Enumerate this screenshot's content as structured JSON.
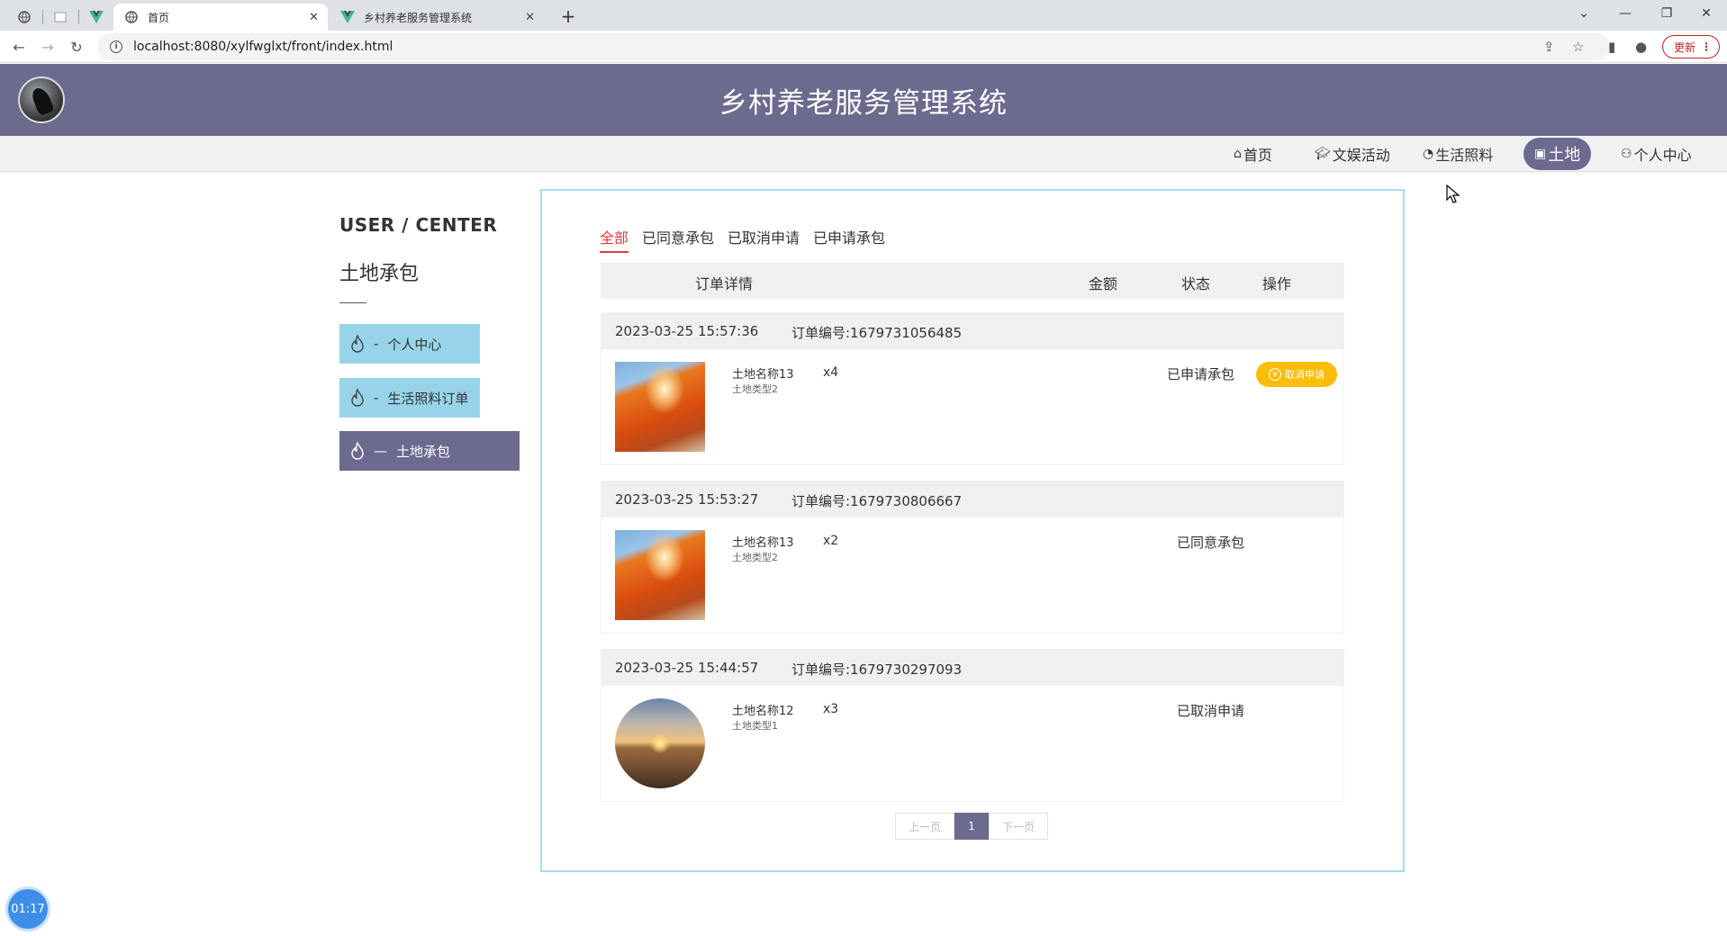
{
  "browser": {
    "tabs": [
      {
        "title": "",
        "icon": "globe-icon"
      },
      {
        "title": "",
        "icon": "blank-page-icon"
      },
      {
        "title": "",
        "icon": "vue-logo-icon"
      },
      {
        "title": "首页",
        "icon": "globe-icon",
        "active": true
      },
      {
        "title": "乡村养老服务管理系统",
        "icon": "vue-logo-icon"
      }
    ],
    "url": "localhost:8080/xylfwglxt/front/index.html",
    "update_label": "更新"
  },
  "header": {
    "title": "乡村养老服务管理系统"
  },
  "nav": [
    {
      "label": "首页",
      "icon": "home-icon"
    },
    {
      "label": "文娱活动",
      "icon": "graduation-cap-icon"
    },
    {
      "label": "生活照料",
      "icon": "gamepad-icon"
    },
    {
      "label": "土地",
      "icon": "gift-icon",
      "active": true
    },
    {
      "label": "个人中心",
      "icon": "user-icon"
    }
  ],
  "sidebar": {
    "title": "USER / CENTER",
    "subtitle": "土地承包",
    "items": [
      {
        "label": "个人中心",
        "prefix": "-"
      },
      {
        "label": "生活照料订单",
        "prefix": "-"
      },
      {
        "label": "土地承包",
        "prefix": "—",
        "active": true
      }
    ]
  },
  "filters": [
    "全部",
    "已同意承包",
    "已取消申请",
    "已申请承包"
  ],
  "table_headers": {
    "detail": "订单详情",
    "amount": "金额",
    "status": "状态",
    "action": "操作"
  },
  "orders": [
    {
      "time": "2023-03-25 15:57:36",
      "order_no": "订单编号:1679731056485",
      "name": "土地名称13",
      "type": "土地类型2",
      "qty": "x4",
      "status": "已申请承包",
      "action": "取消申请",
      "image": "red-rock"
    },
    {
      "time": "2023-03-25 15:53:27",
      "order_no": "订单编号:1679730806667",
      "name": "土地名称13",
      "type": "土地类型2",
      "qty": "x2",
      "status": "已同意承包",
      "image": "red-rock"
    },
    {
      "time": "2023-03-25 15:44:57",
      "order_no": "订单编号:1679730297093",
      "name": "土地名称12",
      "type": "土地类型1",
      "qty": "x3",
      "status": "已取消申请",
      "image": "desert-sunset"
    }
  ],
  "pager": {
    "prev": "上一页",
    "current": "1",
    "next": "下一页"
  },
  "timer": "01:17",
  "colors": {
    "primary": "#6c6a8e",
    "menu_light": "#97d4ea",
    "card_border": "#a6dcef",
    "filter_active": "#e3393c",
    "cancel_button": "#fbbd08"
  }
}
